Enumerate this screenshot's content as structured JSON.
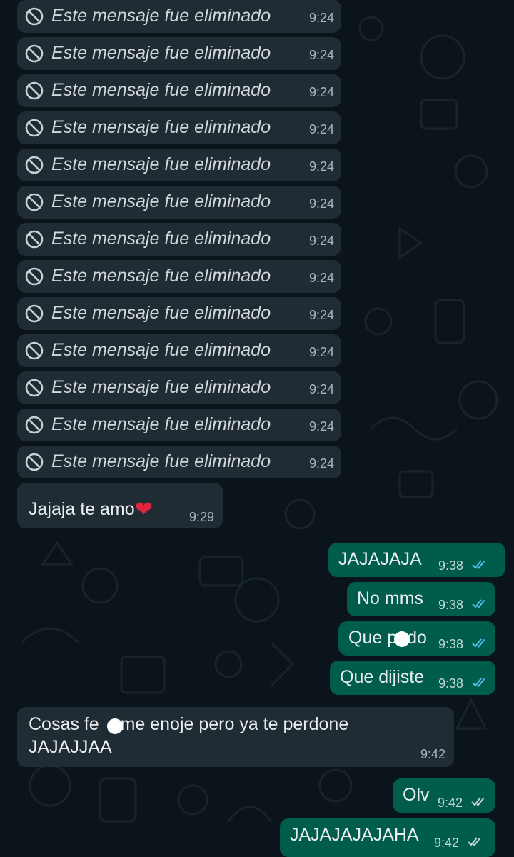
{
  "deleted_messages": {
    "text": "Este mensaje fue eliminado",
    "time": "9:24",
    "count": 13
  },
  "messages": {
    "m1": {
      "text": "Jajaja te amo",
      "emoji": "❤",
      "time": "9:29"
    },
    "m2": {
      "text": "JAJAJAJA",
      "time": "9:38",
      "status": "read"
    },
    "m3": {
      "text": "No mms",
      "time": "9:38",
      "status": "read"
    },
    "m4": {
      "text_before": "Que p",
      "text_after": "do",
      "time": "9:38",
      "status": "read"
    },
    "m5": {
      "text": "Que dijiste",
      "time": "9:38",
      "status": "read"
    },
    "m6": {
      "line1_before": "Cosas fe",
      "line1_after": ", me enoje pero ya te perdone",
      "line2": "JAJAJJAA",
      "time": "9:42"
    },
    "m7": {
      "text": "Olv",
      "time": "9:42",
      "status": "delivered"
    },
    "m8": {
      "text": "JAJAJAJAJAHA",
      "time": "9:42",
      "status": "delivered"
    }
  },
  "colors": {
    "background": "#0b141a",
    "incoming_bubble": "#1f2c34",
    "outgoing_bubble": "#005c4b",
    "read_ticks": "#53bdeb",
    "delivered_ticks": "#c4d7d2"
  }
}
